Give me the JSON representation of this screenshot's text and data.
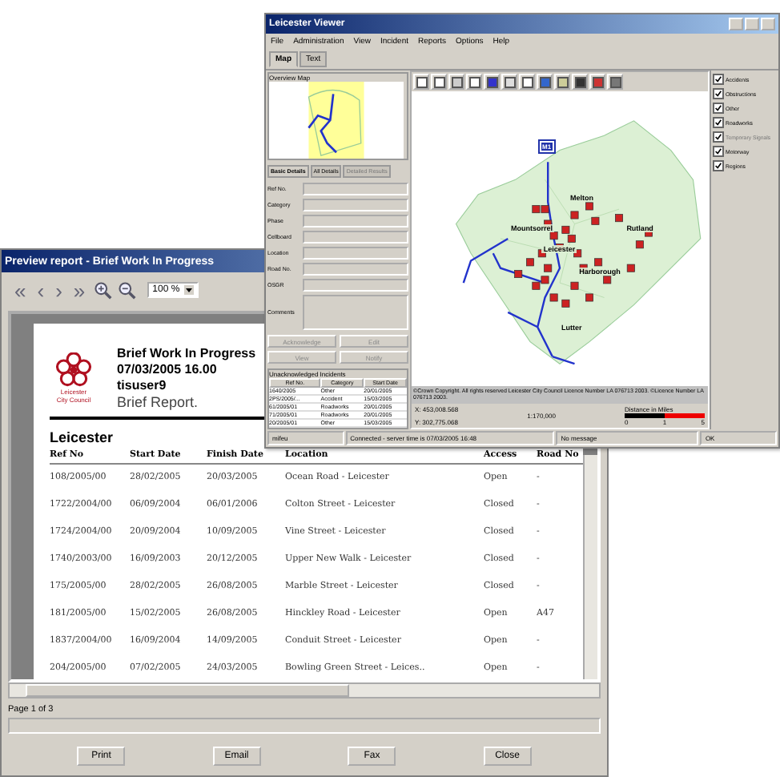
{
  "viewer": {
    "title": "Leicester Viewer",
    "menu": [
      "File",
      "Administration",
      "View",
      "Incident",
      "Reports",
      "Options",
      "Help"
    ],
    "tabs": [
      {
        "label": "Map",
        "selected": true
      },
      {
        "label": "Text",
        "selected": false
      }
    ],
    "overview_title": "Overview Map",
    "detail_tabs": [
      {
        "label": "Basic Details",
        "selected": true,
        "disabled": false
      },
      {
        "label": "All Details",
        "selected": false,
        "disabled": false
      },
      {
        "label": "Detailed Results",
        "selected": false,
        "disabled": true
      }
    ],
    "fields": [
      "Ref No.",
      "Category",
      "Phase",
      "Cellboard",
      "Location",
      "Road No.",
      "OSGR",
      "Comments"
    ],
    "buttons": [
      "Acknowledge",
      "Edit",
      "View",
      "Notify"
    ],
    "incidents": {
      "title": "Unacknowledged Incidents",
      "columns": [
        "Ref No.",
        "Category",
        "Start Date"
      ],
      "rows": [
        [
          "1640/2005",
          "Other",
          "20/01/2005"
        ],
        [
          "2PS/2005/...",
          "Accident",
          "15/03/2005"
        ],
        [
          "61/2005/01",
          "Roadworks",
          "20/01/2005"
        ],
        [
          "71/2005/01",
          "Roadworks",
          "20/01/2005"
        ],
        [
          "20/2005/01",
          "Other",
          "15/03/2005"
        ]
      ]
    },
    "layers": [
      {
        "label": "Accidents",
        "checked": true,
        "disabled": false
      },
      {
        "label": "Obstructions",
        "checked": true,
        "disabled": false
      },
      {
        "label": "Other",
        "checked": true,
        "disabled": false
      },
      {
        "label": "Roadworks",
        "checked": true,
        "disabled": false
      },
      {
        "label": "Temporary Signals",
        "checked": true,
        "disabled": true
      },
      {
        "label": "Motorway",
        "checked": true,
        "disabled": false
      },
      {
        "label": "Regions",
        "checked": true,
        "disabled": false
      }
    ],
    "road_label": "M1",
    "places": [
      "Melton",
      "Mountsorrel",
      "Rutland",
      "Leicester",
      "Harborough",
      "Lutter"
    ],
    "copyright": "©Crown Copyright. All rights reserved Leicester City Council Licence Number LA 076713 2003. ©Licence Number LA 076713 2003.",
    "coord_x": "X: 453,008.568",
    "coord_y": "Y: 302,775.068",
    "scale": "1:170,000",
    "distance": "Distance in Miles",
    "ticks": [
      "0",
      "1",
      "5"
    ],
    "status": [
      "mifeu",
      "Connected - server time is 07/03/2005 16:48",
      "No message",
      "OK"
    ]
  },
  "report": {
    "title": "Preview report - Brief Work In Progress",
    "nav": [
      "«",
      "‹",
      "›",
      "»"
    ],
    "zoom": "100 %",
    "logo_text": [
      "Leicester",
      "City Council"
    ],
    "heading": [
      "Brief Work In Progress",
      "07/03/2005 16.00",
      "tisuser9"
    ],
    "subtitle": "Brief Report.",
    "section": "Leicester",
    "columns": [
      "Ref No",
      "Start Date",
      "Finish Date",
      "Location",
      "Access",
      "Road No"
    ],
    "rows": [
      [
        "108/2005/00",
        "28/02/2005",
        "20/03/2005",
        "Ocean Road - Leicester",
        "Open",
        "-"
      ],
      [
        "1722/2004/00",
        "06/09/2004",
        "06/01/2006",
        "Colton Street - Leicester",
        "Closed",
        "-"
      ],
      [
        "1724/2004/00",
        "20/09/2004",
        "10/09/2005",
        "Vine Street - Leicester",
        "Closed",
        "-"
      ],
      [
        "1740/2003/00",
        "16/09/2003",
        "20/12/2005",
        "Upper New Walk - Leicester",
        "Closed",
        "-"
      ],
      [
        "175/2005/00",
        "28/02/2005",
        "26/08/2005",
        "Marble Street - Leicester",
        "Closed",
        "-"
      ],
      [
        "181/2005/00",
        "15/02/2005",
        "26/08/2005",
        "Hinckley Road - Leicester",
        "Open",
        "A47"
      ],
      [
        "1837/2004/00",
        "16/09/2004",
        "14/09/2005",
        "Conduit Street - Leicester",
        "Open",
        "-"
      ],
      [
        "204/2005/00",
        "07/02/2005",
        "24/03/2005",
        "Bowling Green Street - Leices..",
        "Open",
        "-"
      ]
    ],
    "page": "Page 1 of 3",
    "buttons": [
      "Print",
      "Email",
      "Fax",
      "Close"
    ]
  }
}
